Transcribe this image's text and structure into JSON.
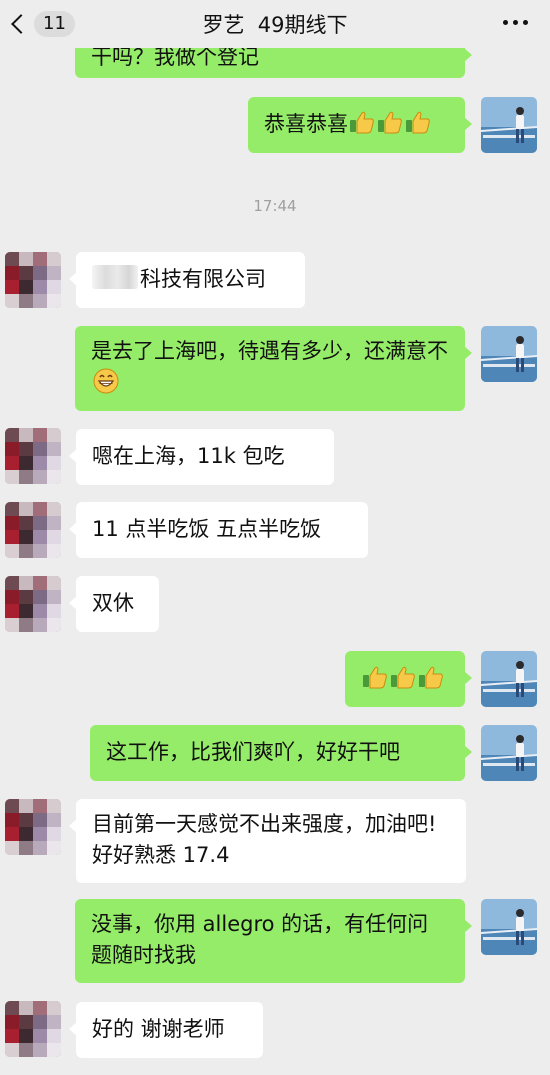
{
  "header": {
    "back_count": "11",
    "title": "罗艺  49期线下"
  },
  "timestamp": "17:44",
  "messages": [
    {
      "side": "out",
      "text": "干吗？我做个登记"
    },
    {
      "side": "out",
      "text": "恭喜恭喜",
      "emoji": [
        "thumbs-up",
        "thumbs-up",
        "thumbs-up"
      ]
    },
    {
      "side": "in",
      "text": "科技有限公司",
      "redacted_prefix": true
    },
    {
      "side": "out",
      "text": "是去了上海吧，待遇有多少，还满意不",
      "emoji": [
        "grin"
      ]
    },
    {
      "side": "in",
      "text": "嗯在上海，11k 包吃"
    },
    {
      "side": "in",
      "text": "11 点半吃饭 五点半吃饭"
    },
    {
      "side": "in",
      "text": "双休"
    },
    {
      "side": "out",
      "text": "",
      "emoji": [
        "thumbs-up",
        "thumbs-up",
        "thumbs-up"
      ]
    },
    {
      "side": "out",
      "text": "这工作，比我们爽吖，好好干吧"
    },
    {
      "side": "in",
      "text": "目前第一天感觉不出来强度，加油吧!好好熟悉 17.4"
    },
    {
      "side": "out",
      "text": "没事，你用 allegro 的话，有任何问题随时找我"
    },
    {
      "side": "in",
      "text": "好的 谢谢老师"
    }
  ],
  "colors": {
    "background": "#ededed",
    "outgoing_bubble": "#95ec69",
    "incoming_bubble": "#ffffff"
  }
}
